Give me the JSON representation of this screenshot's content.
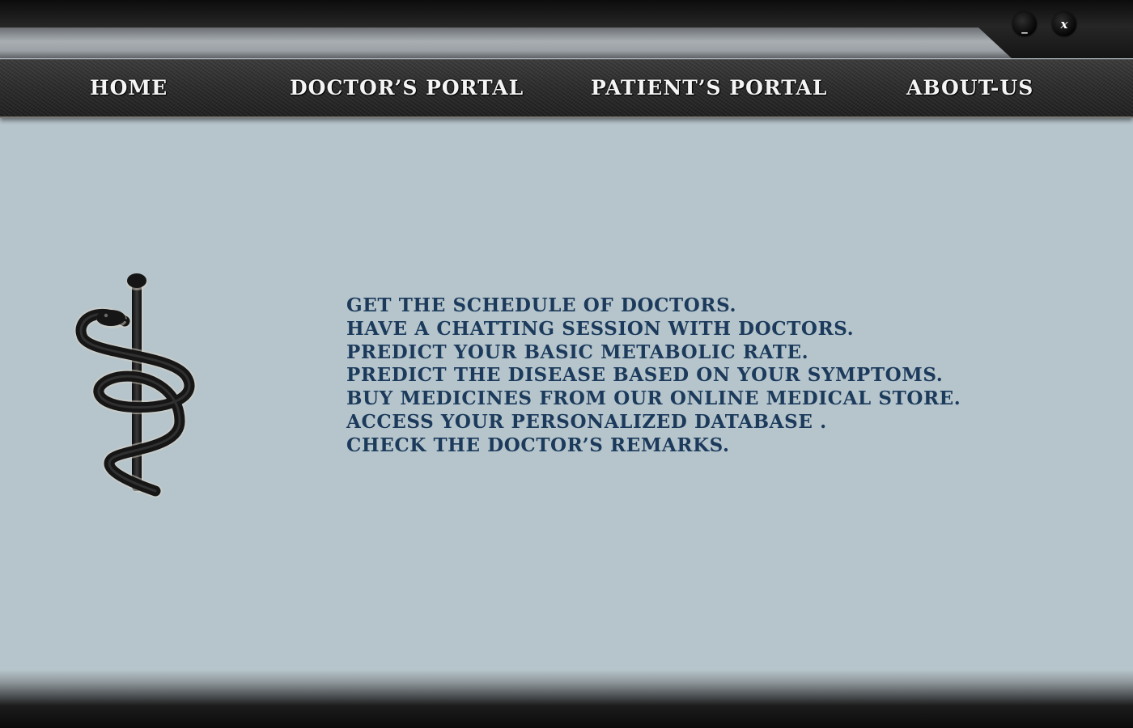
{
  "window_controls": {
    "minimize_label": "_",
    "close_label": "x"
  },
  "nav": {
    "items": [
      {
        "label": "HOME"
      },
      {
        "label": "DOCTOR’S PORTAL"
      },
      {
        "label": "PATIENT’S PORTAL"
      },
      {
        "label": "ABOUT-US"
      }
    ]
  },
  "emblem": {
    "icon": "rod-of-asclepius-icon"
  },
  "features": [
    "GET THE SCHEDULE OF DOCTORS.",
    "HAVE A CHATTING SESSION WITH DOCTORS.",
    "PREDICT YOUR BASIC METABOLIC RATE.",
    "PREDICT THE DISEASE BASED ON YOUR SYMPTOMS.",
    "BUY MEDICINES FROM OUR ONLINE MEDICAL STORE.",
    "ACCESS YOUR PERSONALIZED DATABASE .",
    "CHECK THE DOCTOR’S REMARKS."
  ],
  "colors": {
    "background": "#b6c5cb",
    "feature_text": "#1b3a5c",
    "nav_text": "#f4f4f4",
    "nav_bar": "#2a2a2a"
  }
}
